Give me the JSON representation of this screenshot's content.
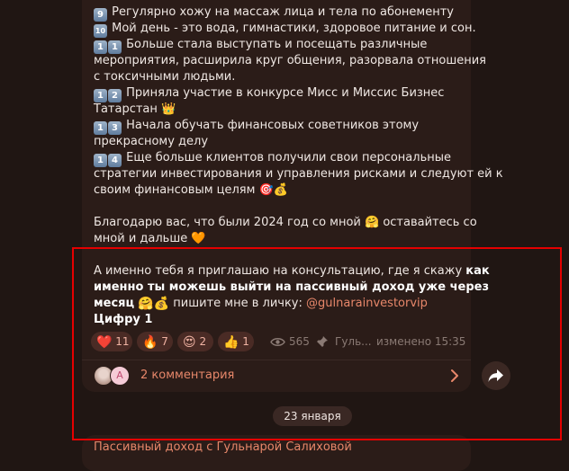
{
  "message": {
    "items": [
      {
        "num": [
          "9"
        ],
        "text": "Регулярно хожу на массаж лица и тела по абонементу"
      },
      {
        "num": [
          "10"
        ],
        "text": "Мой день - это вода, гимнастики, здоровое питание и сон."
      },
      {
        "num": [
          "1",
          "1"
        ],
        "text": "Больше стала выступать и посещать различные",
        "cont": [
          "мероприятия, расширила круг общения, разорвала отношения",
          "с токсичными людьми."
        ]
      },
      {
        "num": [
          "1",
          "2"
        ],
        "text": "Приняла участие в конкурсе Мисс и Миссис Бизнес",
        "cont": [
          "Татарстан 👑"
        ]
      },
      {
        "num": [
          "1",
          "3"
        ],
        "text": "Начала обучать финансовых советников этому",
        "cont": [
          "прекрасному делу"
        ]
      },
      {
        "num": [
          "1",
          "4"
        ],
        "text": "Еще больше клиентов получили свои персональные",
        "cont": [
          "стратегии инвестирования и управления рисками и следуют ей к",
          "своим финансовым целям 🎯💰"
        ]
      }
    ],
    "thanks_line1": "Благодарю вас, что были 2024 год со мной 🤗 оставайтесь со",
    "thanks_line2": "мной и дальше 🧡",
    "invite": {
      "p1": "А именно тебя я приглашаю на консультацию, где я скажу ",
      "b1": "как",
      "b2": "именно ты можешь выйти на  пассивный  доход уже через",
      "b3": "месяц",
      "emoji": "🤗💰",
      "p2": "  пишите мне в личку: ",
      "link": "@gulnarainvestorvip",
      "last": "Цифру 1"
    }
  },
  "reactions": [
    {
      "emoji": "❤️",
      "count": "11"
    },
    {
      "emoji": "🔥",
      "count": "7"
    },
    {
      "emoji": "😍",
      "count": "2"
    },
    {
      "emoji": "👍",
      "count": "1"
    }
  ],
  "meta": {
    "views": "565",
    "author": "Гуль...",
    "edited": "изменено 15:35"
  },
  "comments": {
    "label": "2 комментария",
    "avatar_letter": "А"
  },
  "date_separator": "23 января",
  "next_post_title": "Пассивный доход с Гульнарой Салиховой",
  "colors": {
    "accent": "#e7876a",
    "background": "#201613",
    "bubble": "#2b1c18",
    "highlight_box": "#e50000"
  }
}
